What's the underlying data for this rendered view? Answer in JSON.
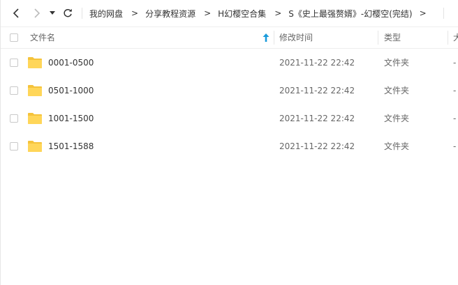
{
  "toolbar": {
    "back_icon": "chevron-left-icon",
    "forward_icon": "chevron-right-icon",
    "history_icon": "caret-down-icon",
    "refresh_icon": "refresh-icon",
    "breadcrumb": [
      {
        "label": "我的网盘"
      },
      {
        "label": "分享教程资源"
      },
      {
        "label": "H幻樱空合集"
      },
      {
        "label": "S《史上最强赘婿》-幻樱空(完结)"
      }
    ],
    "separator": ">"
  },
  "header": {
    "name": "文件名",
    "mtime": "修改时间",
    "type": "类型",
    "size": "大",
    "sort_icon": "arrow-up-icon",
    "accent_color": "#1a9bdb"
  },
  "files": [
    {
      "name": "0001-0500",
      "mtime": "2021-11-22 22:42",
      "type": "文件夹",
      "size": "-"
    },
    {
      "name": "0501-1000",
      "mtime": "2021-11-22 22:42",
      "type": "文件夹",
      "size": "-"
    },
    {
      "name": "1001-1500",
      "mtime": "2021-11-22 22:42",
      "type": "文件夹",
      "size": "-"
    },
    {
      "name": "1501-1588",
      "mtime": "2021-11-22 22:42",
      "type": "文件夹",
      "size": "-"
    }
  ],
  "colors": {
    "folder": "#ffd659",
    "folder_tab": "#f5c33b"
  }
}
